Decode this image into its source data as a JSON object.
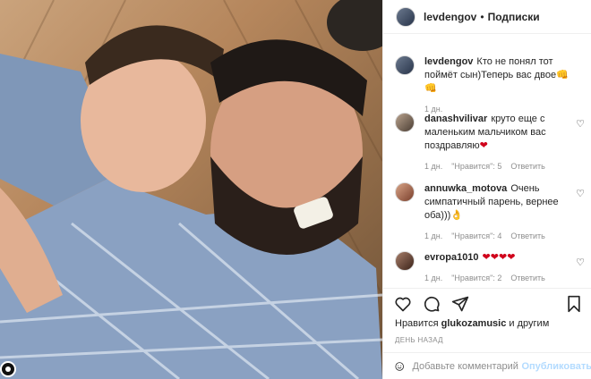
{
  "post": {
    "author": "levdengov",
    "header_separator": "•",
    "follow_label": "Подписки",
    "caption": {
      "user": "levdengov",
      "text": "Кто не понял тот поймёт сын)Теперь вас двое",
      "emoji": "👊👊",
      "time": "1 дн."
    }
  },
  "comments": [
    {
      "user": "danashvilivar",
      "text": "круто еще с маленьким мальчиком вас поздравляю",
      "emoji": "❤",
      "time": "1 дн.",
      "likes": "\"Нравится\": 5",
      "reply": "Ответить"
    },
    {
      "user": "annuwka_motova",
      "text": "Очень симпатичный парень, вернее оба)))",
      "emoji": "👌",
      "time": "1 дн.",
      "likes": "\"Нравится\": 4",
      "reply": "Ответить"
    },
    {
      "user": "evropa1010",
      "text": "",
      "emoji": "❤❤❤❤",
      "time": "1 дн.",
      "likes": "\"Нравится\": 2",
      "reply": "Ответить"
    }
  ],
  "likes_line": {
    "prefix": "Нравится",
    "user": "glukozamusic",
    "suffix": "и другим"
  },
  "time_ago": "ДЕНЬ НАЗАД",
  "add_comment": {
    "placeholder": "Добавьте комментарий...",
    "publish": "Опубликовать"
  },
  "icons": [
    "heart-icon",
    "comment-icon",
    "share-icon",
    "bookmark-icon",
    "emoji-icon",
    "profile-tag-icon"
  ],
  "colors": {
    "accent_disabled": "#b3dbff",
    "heart_red": "#d0021b",
    "muted": "#8e8e8e"
  }
}
